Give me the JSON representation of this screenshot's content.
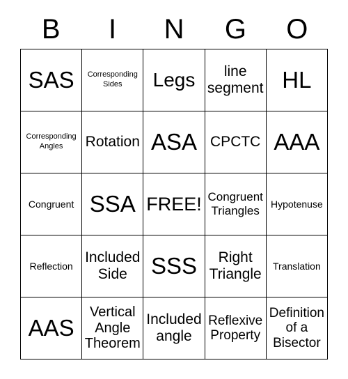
{
  "card": {
    "header_letters": [
      "B",
      "I",
      "N",
      "G",
      "O"
    ],
    "free_space_label": "FREE!",
    "colors": {
      "background": "#ffffff",
      "text": "#000000",
      "border": "#000000"
    },
    "grid": {
      "columns": 5,
      "rows": 5
    },
    "cells": [
      {
        "text": "SAS",
        "size": "xl"
      },
      {
        "text": "Corresponding\nSides",
        "size": "xxs"
      },
      {
        "text": "Legs",
        "size": "lg"
      },
      {
        "text": "line\nsegment",
        "size": "md"
      },
      {
        "text": "HL",
        "size": "xl"
      },
      {
        "text": "Corresponding\nAngles",
        "size": "xxs"
      },
      {
        "text": "Rotation",
        "size": "md"
      },
      {
        "text": "ASA",
        "size": "xl"
      },
      {
        "text": "CPCTC",
        "size": "md"
      },
      {
        "text": "AAA",
        "size": "xl"
      },
      {
        "text": "Congruent",
        "size": "xs"
      },
      {
        "text": "SSA",
        "size": "xl"
      },
      {
        "text": "FREE!",
        "size": "lg"
      },
      {
        "text": "Congruent\nTriangles",
        "size": "sm"
      },
      {
        "text": "Hypotenuse",
        "size": "xs"
      },
      {
        "text": "Reflection",
        "size": "xs"
      },
      {
        "text": "Included\nSide",
        "size": "md"
      },
      {
        "text": "SSS",
        "size": "xl"
      },
      {
        "text": "Right\nTriangle",
        "size": "md"
      },
      {
        "text": "Translation",
        "size": "xs"
      },
      {
        "text": "AAS",
        "size": "xl"
      },
      {
        "text": "Vertical\nAngle\nTheorem",
        "size": "md"
      },
      {
        "text": "Included\nangle",
        "size": "md"
      },
      {
        "text": "Reflexive\nProperty",
        "size": "md"
      },
      {
        "text": "Definition\nof a\nBisector",
        "size": "md"
      }
    ]
  }
}
